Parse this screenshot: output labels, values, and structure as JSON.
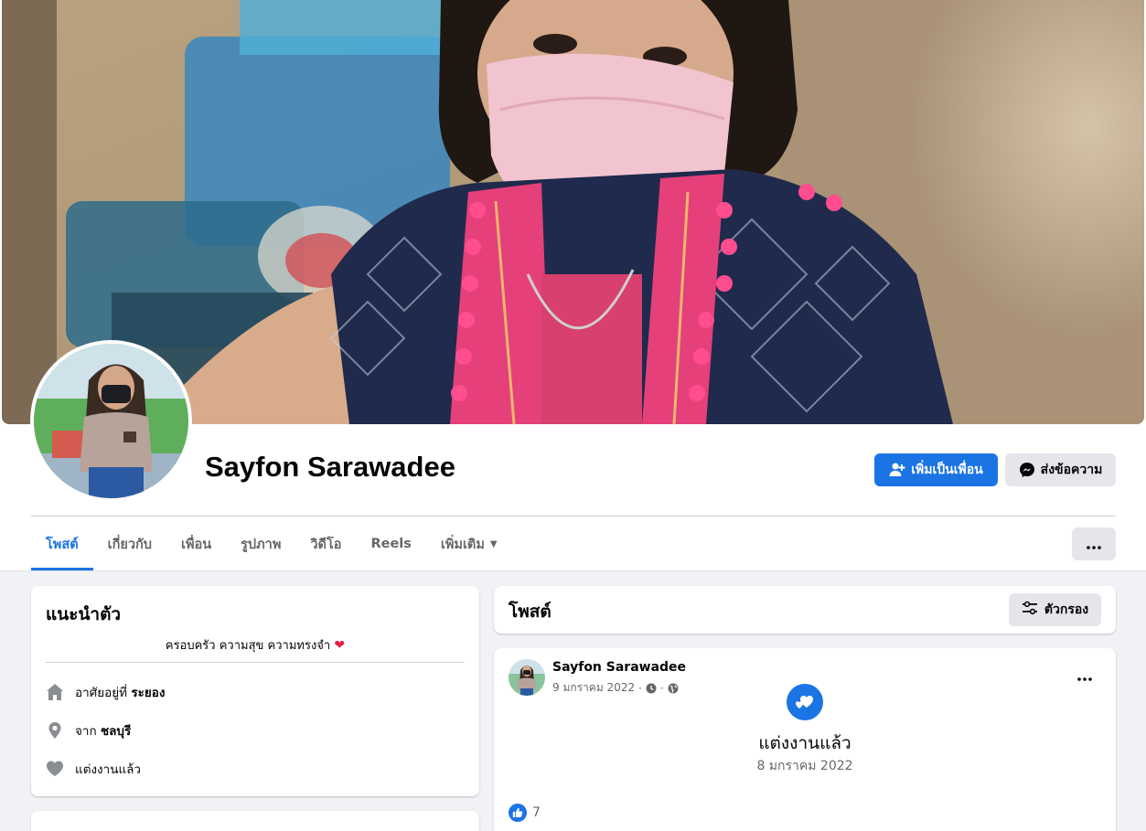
{
  "profile": {
    "name": "Sayfon Sarawadee",
    "actions": {
      "add_friend_label": "เพิ่มเป็นเพื่อน",
      "message_label": "ส่งข้อความ"
    }
  },
  "tabs": [
    {
      "label": "โพสต์",
      "active": true
    },
    {
      "label": "เกี่ยวกับ",
      "active": false
    },
    {
      "label": "เพื่อน",
      "active": false
    },
    {
      "label": "รูปภาพ",
      "active": false
    },
    {
      "label": "วิดีโอ",
      "active": false
    },
    {
      "label": "Reels",
      "active": false
    },
    {
      "label": "เพิ่มเติม",
      "active": false
    }
  ],
  "intro": {
    "title": "แนะนำตัว",
    "bio": "ครอบครัว ความสุข ความทรงจำ",
    "items": [
      {
        "icon": "home-icon",
        "prefix": "อาศัยอยู่ที่",
        "value": "ระยอง"
      },
      {
        "icon": "location-pin-icon",
        "prefix": "จาก",
        "value": "ชลบุรี"
      },
      {
        "icon": "heart-icon",
        "prefix": "แต่งงานแล้ว",
        "value": ""
      }
    ]
  },
  "posts_section": {
    "title": "โพสต์",
    "filter_label": "ตัวกรอง"
  },
  "post": {
    "author": "Sayfon Sarawadee",
    "date": "9 มกราคม 2022",
    "separator": "·",
    "life_event_title": "แต่งงานแล้ว",
    "life_event_date": "8 มกราคม 2022",
    "like_count": "7"
  },
  "colors": {
    "primary": "#1b74e4",
    "background": "#f0f2f5",
    "heart": "#e41e3f",
    "secondary_text": "#65676b"
  }
}
